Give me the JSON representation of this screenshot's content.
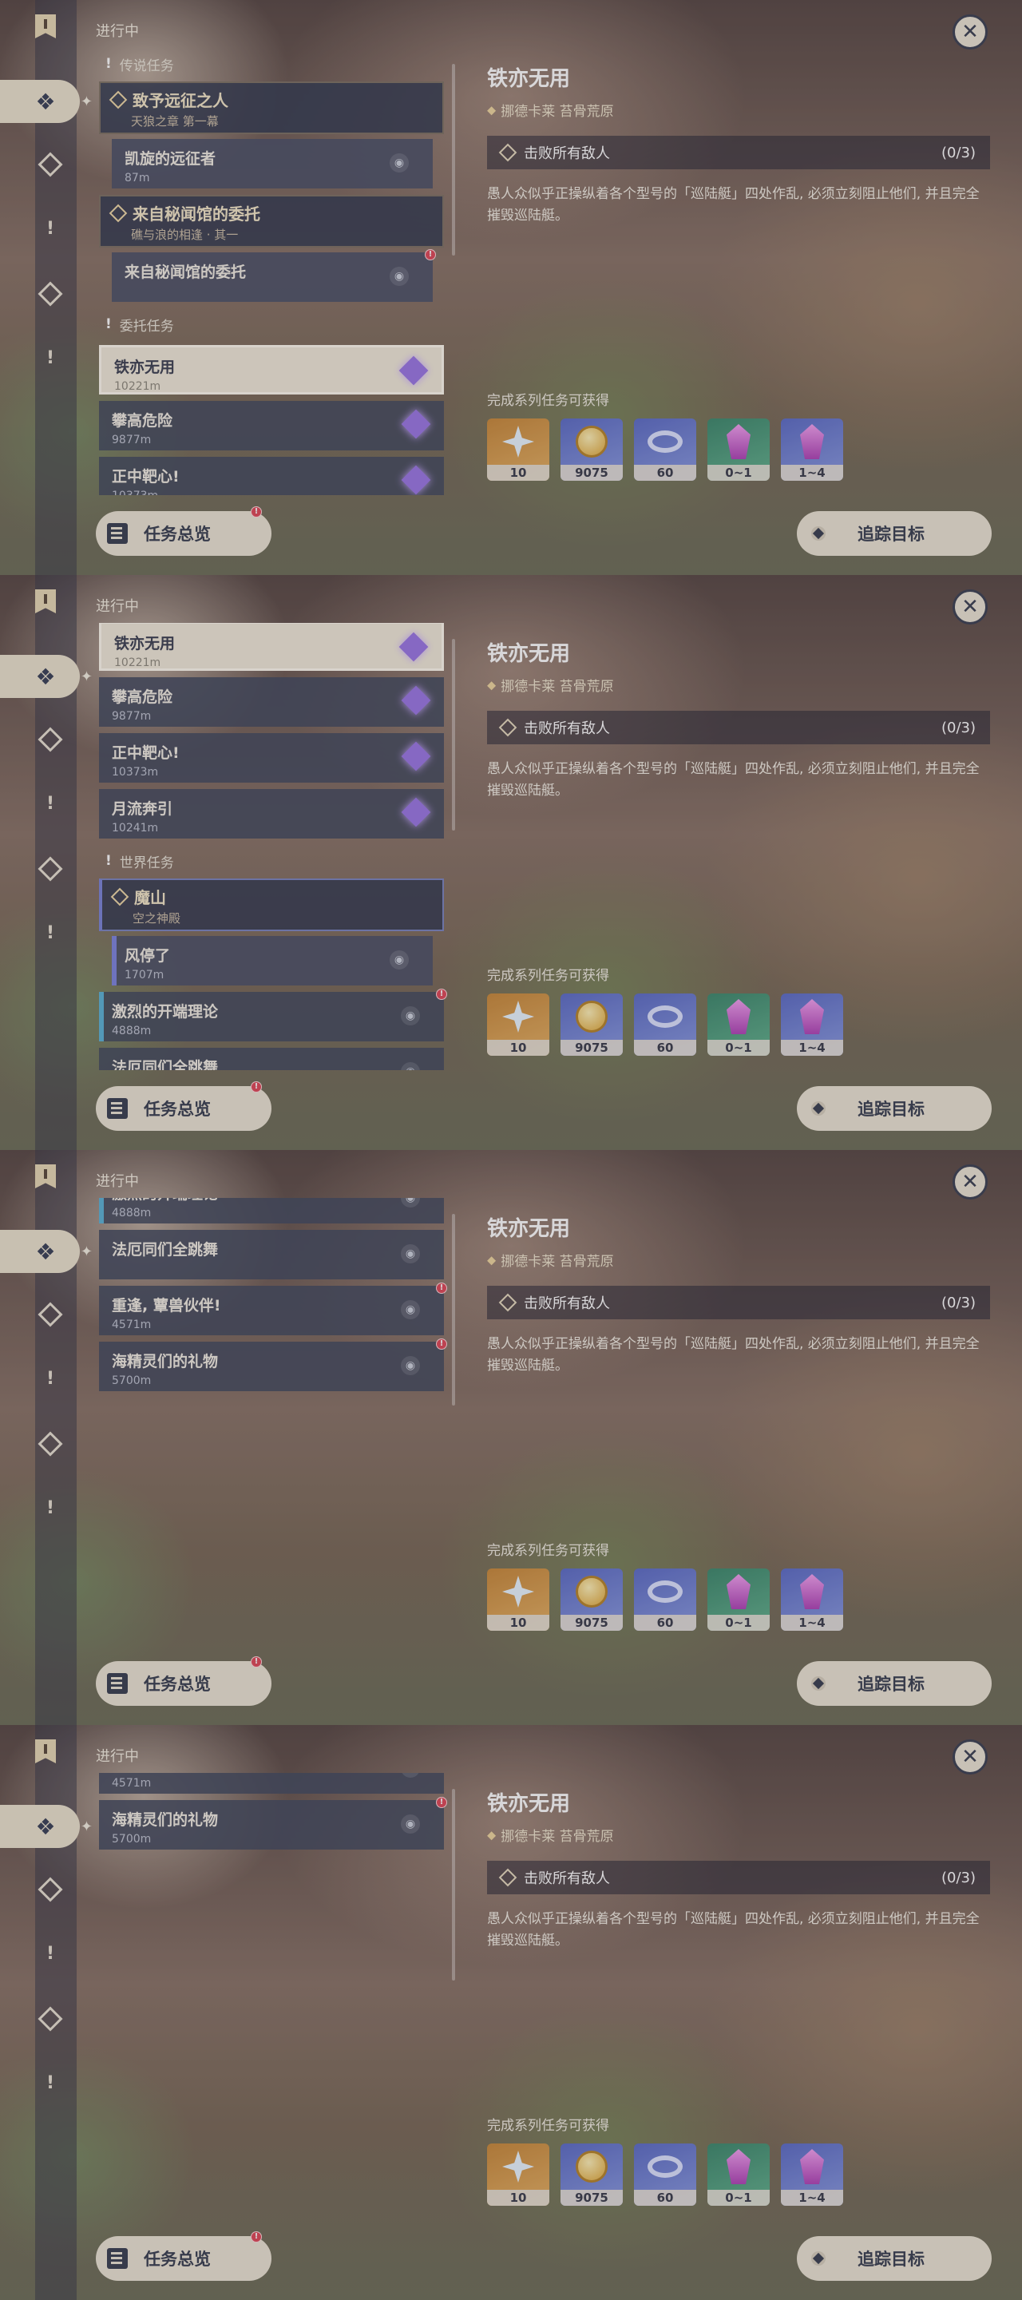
{
  "status_title": "进行中",
  "sections": {
    "legend": "传说任务",
    "commission": "委托任务",
    "world": "世界任务"
  },
  "legend_groups": [
    {
      "title": "致予远征之人",
      "subtitle": "天狼之章 第一幕",
      "quest": "凯旋的远征者",
      "distance": "87m"
    },
    {
      "title": "来自秘闻馆的委托",
      "subtitle": "礁与浪的相逢 · 其一",
      "quest": "来自秘闻馆的委托",
      "distance": ""
    }
  ],
  "commissions": [
    {
      "title": "铁亦无用",
      "distance": "10221m"
    },
    {
      "title": "攀高危险",
      "distance": "9877m"
    },
    {
      "title": "正中靶心!",
      "distance": "10373m"
    },
    {
      "title": "月流奔引",
      "distance": "10241m"
    }
  ],
  "world_group": {
    "title": "魔山",
    "subtitle": "空之神殿",
    "quest": "风停了",
    "distance": "1707m"
  },
  "world_quests": [
    {
      "title": "激烈的开端理论",
      "distance": "4888m"
    },
    {
      "title": "法厄同们全跳舞",
      "distance": ""
    },
    {
      "title": "重逢, 蕈兽伙伴!",
      "distance": "4571m"
    },
    {
      "title": "海精灵们的礼物",
      "distance": "5700m"
    }
  ],
  "buttons": {
    "overview": "任务总览",
    "track": "追踪目标"
  },
  "detail": {
    "title": "铁亦无用",
    "location": "挪德卡莱 苔骨荒原",
    "objective": "击败所有敌人",
    "progress": "(0/3)",
    "description": "愚人众似乎正操纵着各个型号的「巡陆艇」四处作乱, 必须立刻阻止他们, 并且完全摧毁巡陆艇。",
    "reward_title": "完成系列任务可获得",
    "rewards": [
      {
        "icon": "primogem-icon",
        "count": "10"
      },
      {
        "icon": "mora-coin-icon",
        "count": "9075"
      },
      {
        "icon": "exp-ring-icon",
        "count": "60"
      },
      {
        "icon": "crystal-green-icon",
        "count": "0~1"
      },
      {
        "icon": "crystal-purple-icon",
        "count": "1~4"
      }
    ]
  },
  "colors": {
    "accent_blue": "#5db3d6",
    "accent_violet": "#7e86de",
    "alert_red": "#e04a59",
    "panel_cream": "#ece5d5"
  }
}
